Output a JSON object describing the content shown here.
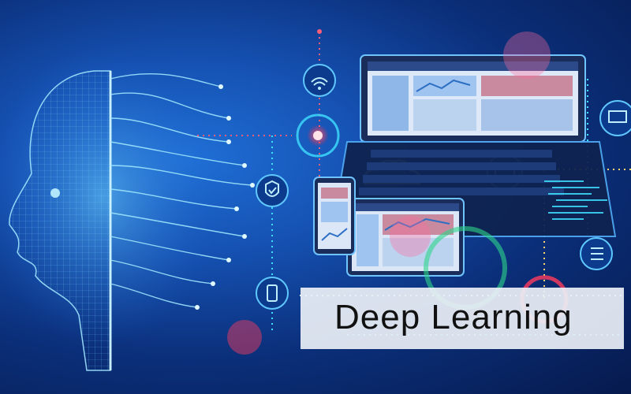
{
  "caption": {
    "text": "Deep Learning"
  },
  "icons": [
    "wifi-icon",
    "shield-check-icon",
    "cloud-icon",
    "monitor-icon",
    "list-icon",
    "smartphone-icon",
    "desktop-icon"
  ],
  "colors": {
    "background": "#0b2f7a",
    "accent_cyan": "#3ee0ff",
    "accent_red": "#ff3b5c",
    "accent_green": "#2fd68a"
  }
}
